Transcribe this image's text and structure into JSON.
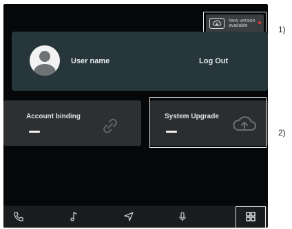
{
  "update_badge": {
    "text": "New version available",
    "icon": "cloud-download-icon",
    "dot_color": "#e03a3a"
  },
  "user": {
    "name": "User name",
    "logout_label": "Log Out",
    "avatar_icon": "user-avatar-icon"
  },
  "tiles": {
    "account_binding": {
      "label": "Account binding",
      "value": "—",
      "icon": "link-icon"
    },
    "system_upgrade": {
      "label": "System Upgrade",
      "value": "—",
      "icon": "cloud-upload-icon"
    }
  },
  "navbar": {
    "items": [
      "phone-icon",
      "music-icon",
      "navigation-icon",
      "microphone-icon",
      "apps-grid-icon"
    ]
  },
  "callouts": {
    "one": "1)",
    "two": "2)"
  },
  "colors": {
    "screen_bg": "#060708",
    "user_card": "#27363b",
    "tile_bg": "#2d2f31",
    "highlight_border": "#e8e8e8"
  }
}
